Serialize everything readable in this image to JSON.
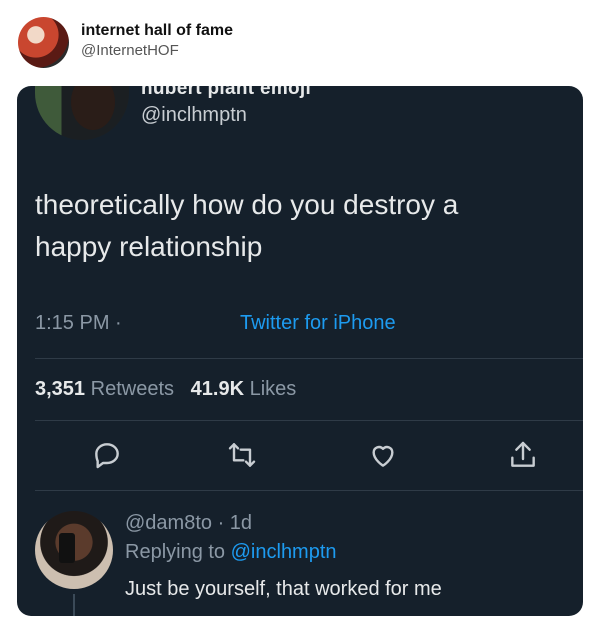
{
  "poster": {
    "name": "internet hall of fame",
    "handle": "@InternetHOF"
  },
  "tweet": {
    "author_name": "hubert plant emoji",
    "author_handle": "@inclhmptn",
    "text_line1": "theoretically how do you destroy a",
    "text_line2": "happy relationship",
    "time": "1:15 PM ·",
    "source": "Twitter for iPhone",
    "retweets_count": "3,351",
    "retweets_label": "Retweets",
    "likes_count": "41.9K",
    "likes_label": "Likes"
  },
  "actions": {
    "reply_icon": "reply-icon",
    "retweet_icon": "retweet-icon",
    "like_icon": "heart-icon",
    "share_icon": "share-icon"
  },
  "reply": {
    "handle": "@dam8to",
    "age": "· 1d",
    "replying_prefix": "Replying to",
    "replying_to": "@inclhmptn",
    "text": "Just be yourself, that worked for me"
  },
  "colors": {
    "card_bg": "#15202b",
    "accent": "#1d9bf0",
    "muted": "#8b98a5",
    "text": "#e7e9ea"
  }
}
